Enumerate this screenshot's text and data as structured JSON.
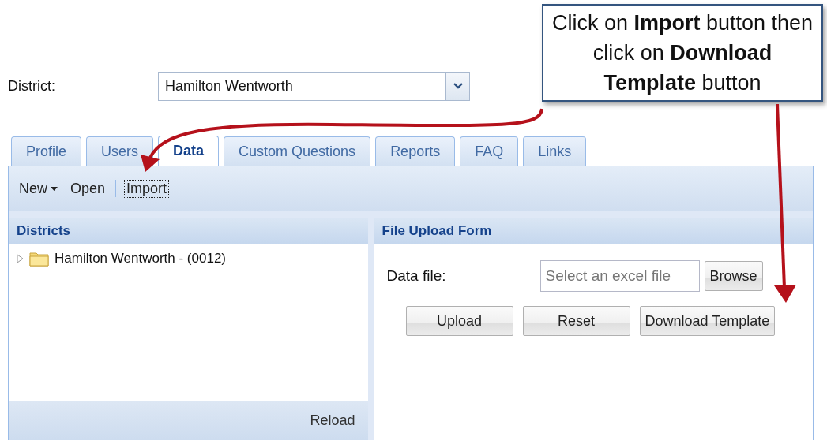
{
  "district": {
    "label": "District:",
    "value": "Hamilton Wentworth"
  },
  "callout": {
    "text": "Click on **Import** button then click on **Download Template** button"
  },
  "tabs": [
    {
      "label": "Profile",
      "selected": false
    },
    {
      "label": "Users",
      "selected": false
    },
    {
      "label": "Data",
      "selected": true
    },
    {
      "label": "Custom Questions",
      "selected": false
    },
    {
      "label": "Reports",
      "selected": false
    },
    {
      "label": "FAQ",
      "selected": false
    },
    {
      "label": "Links",
      "selected": false
    }
  ],
  "toolbar": [
    {
      "kind": "menu",
      "label": "New",
      "focused": false
    },
    {
      "kind": "button",
      "label": "Open",
      "focused": false
    },
    {
      "kind": "separator"
    },
    {
      "kind": "button",
      "label": "Import",
      "focused": true
    }
  ],
  "districts_panel": {
    "title": "Districts",
    "tree": [
      {
        "label": "Hamilton Wentworth - (0012)",
        "expanded": false
      }
    ],
    "footer_button": "Reload"
  },
  "upload_form": {
    "title": "File Upload Form",
    "field_label": "Data file:",
    "placeholder": "Select an excel file",
    "browse_button": "Browse",
    "buttons": [
      "Upload",
      "Reset",
      "Download Template"
    ]
  }
}
